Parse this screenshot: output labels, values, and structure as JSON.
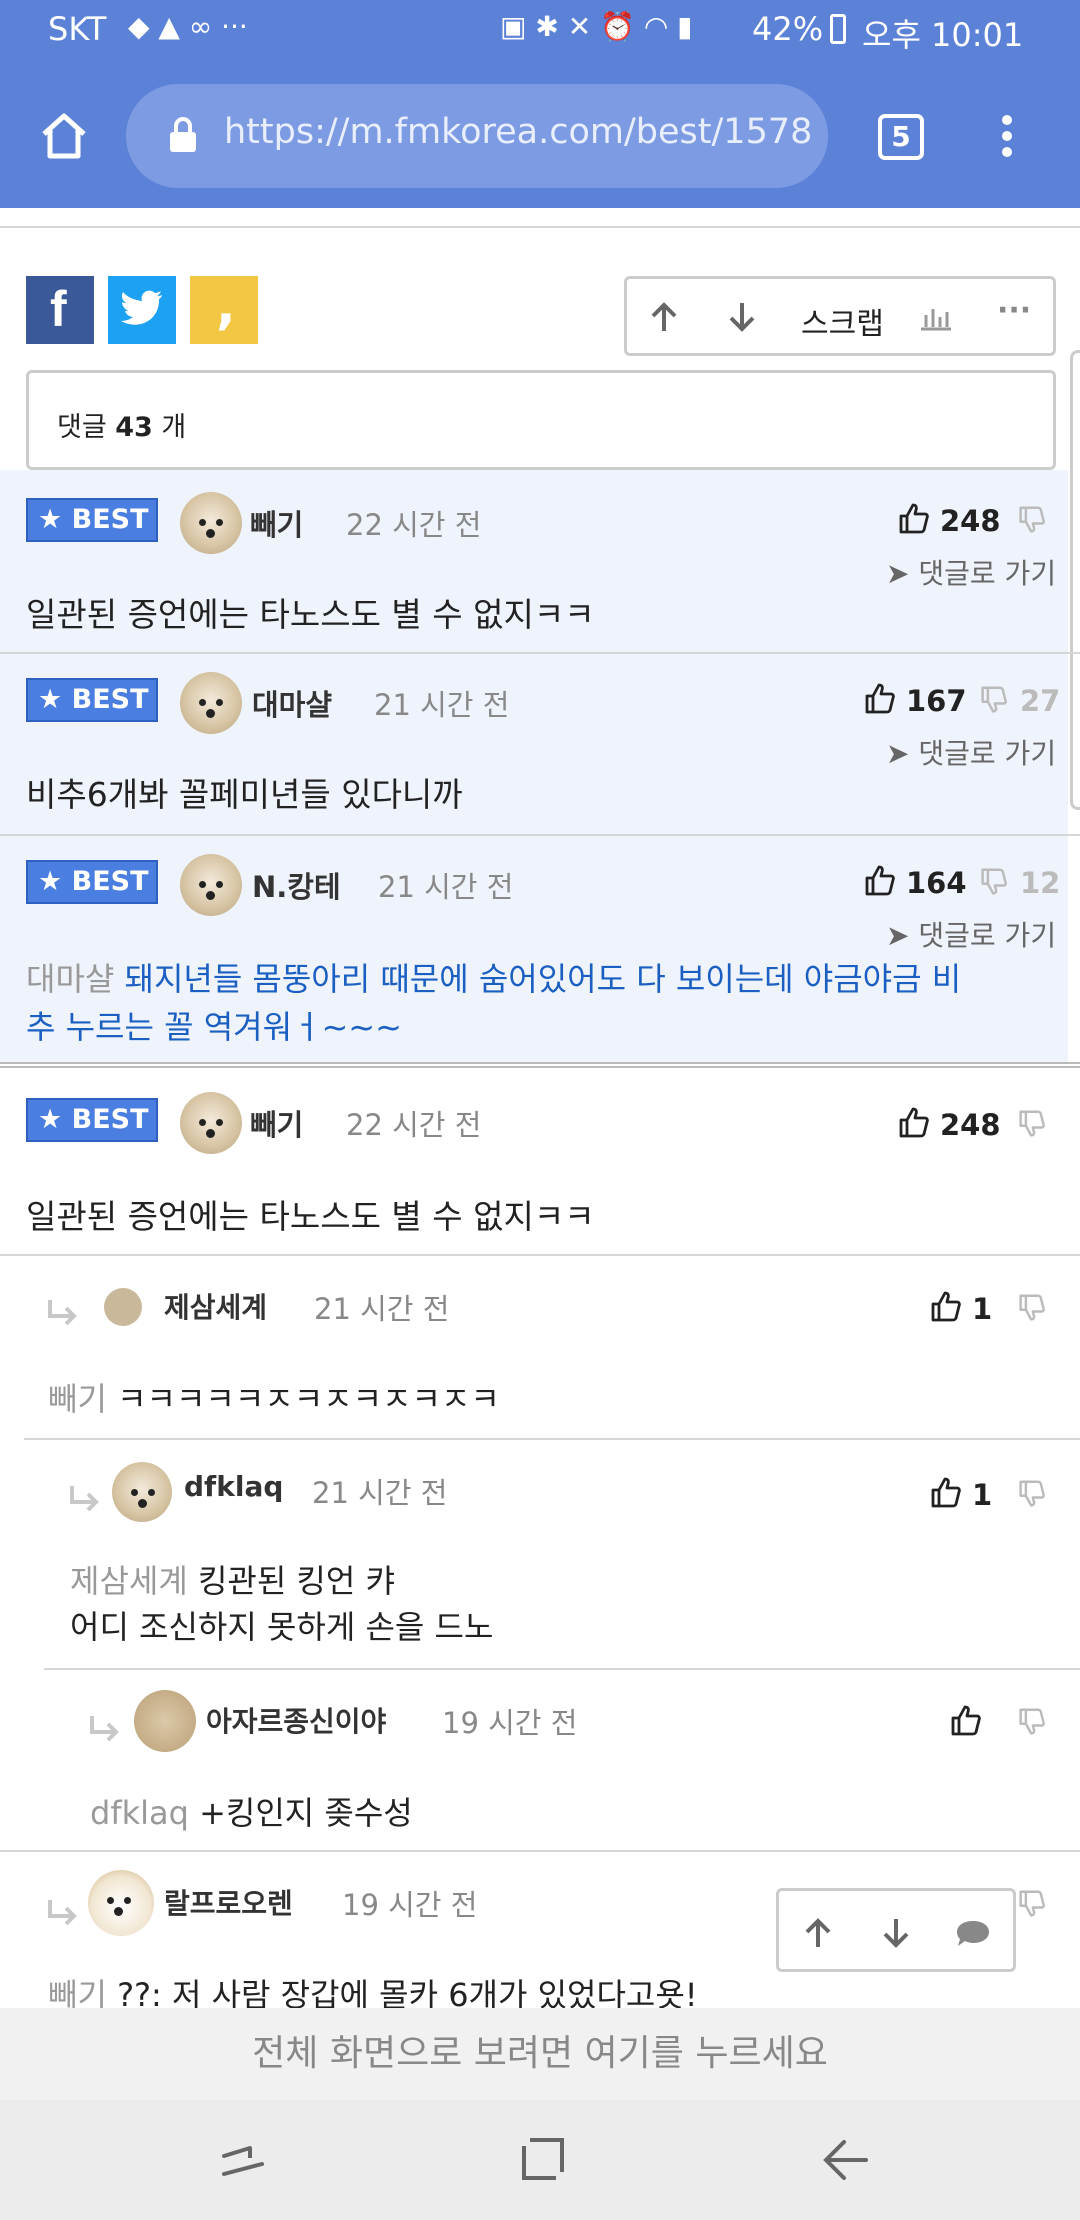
{
  "status": {
    "carrier": "SKT",
    "battery": "42%",
    "time": "오후 10:01"
  },
  "browser": {
    "url": "https://m.fmkorea.com/best/1578",
    "tab_count": "5"
  },
  "toolbar": {
    "scrap_label": "스크랩"
  },
  "comments_header": {
    "prefix": "댓글 ",
    "count": "43",
    "suffix": " 개"
  },
  "goto_label": "댓글로 가기",
  "best": [
    {
      "badge": "BEST",
      "nick": "빼기",
      "time": "22 시간 전",
      "likes": "248",
      "dislikes": "",
      "text": "일관된 증언에는 타노스도 별 수 없지ㅋㅋ"
    },
    {
      "badge": "BEST",
      "nick": "대마샬",
      "time": "21 시간 전",
      "likes": "167",
      "dislikes": "27",
      "text": "비추6개봐 꼴페미년들 있다니까"
    },
    {
      "badge": "BEST",
      "nick": "N.캉테",
      "time": "21 시간 전",
      "likes": "164",
      "dislikes": "12",
      "mention": "대마샬",
      "text_line1": " 돼지년들 몸뚱아리 때문에 숨어있어도 다 보이는데 야금야금 비",
      "text_line2": "추 누르는 꼴 역겨워ㅓ~~~"
    }
  ],
  "thread": {
    "badge": "BEST",
    "nick": "빼기",
    "time": "22 시간 전",
    "likes": "248",
    "text": "일관된 증언에는 타노스도 별 수 없지ㅋㅋ",
    "replies": [
      {
        "nick": "제삼세계",
        "time": "21 시간 전",
        "likes": "1",
        "mention": "빼기",
        "text": " ㅋㅋㅋㅋㅋㅈㅋㅈㅋㅈㅋㅈㅋ"
      },
      {
        "nick": "dfklaq",
        "time": "21 시간 전",
        "likes": "1",
        "mention": "제삼세계",
        "text": " 킹관된 킹언 캬",
        "text2": "어디 조신하지 못하게 손을 드노"
      },
      {
        "nick": "아자르종신이야",
        "time": "19 시간 전",
        "likes": "",
        "mention": "dfklaq",
        "text": " +킹인지 좆수성"
      },
      {
        "nick": "랄프로오렌",
        "time": "19 시간 전",
        "likes": "",
        "mention": "빼기",
        "text": " ??: 저 사람 장갑에 몰카 6개가 있었다고욧!"
      }
    ]
  },
  "banner": "전체 화면으로 보려면 여기를 누르세요"
}
